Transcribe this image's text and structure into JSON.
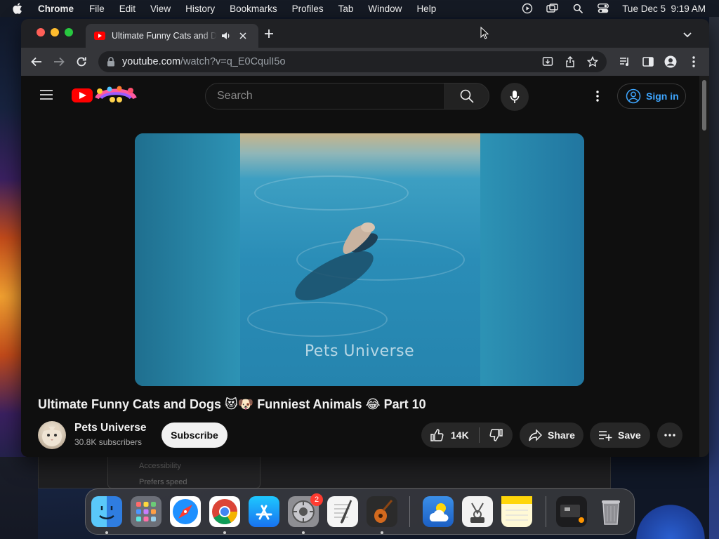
{
  "menubar": {
    "app_name": "Chrome",
    "menus": [
      "File",
      "Edit",
      "View",
      "History",
      "Bookmarks",
      "Profiles",
      "Tab",
      "Window",
      "Help"
    ],
    "datetime": "Tue Dec 5  9:19 AM"
  },
  "browser": {
    "tab_title": "Ultimate Funny Cats and Dogs",
    "url_domain": "youtube.com",
    "url_path": "/watch?v=q_E0CqulI5o"
  },
  "youtube": {
    "search_placeholder": "Search",
    "sign_in_label": "Sign in",
    "video": {
      "watermark": "Pets Universe",
      "title": "Ultimate Funny Cats and Dogs 😻🐶 Funniest Animals 😂 Part 10"
    },
    "channel": {
      "name": "Pets Universe",
      "subscribers": "30.8K subscribers",
      "subscribe_label": "Subscribe"
    },
    "actions": {
      "like_count": "14K",
      "share_label": "Share",
      "save_label": "Save"
    }
  },
  "background_window": {
    "line1": "Accessibility",
    "line2": "Prefers speed"
  },
  "dock": {
    "apps": [
      "Finder",
      "Launchpad",
      "Safari",
      "Google Chrome",
      "App Store",
      "System Settings",
      "TextEdit",
      "GarageBand",
      "Weather",
      "Screenshot",
      "Notes",
      "Downloads",
      "Trash"
    ],
    "system_settings_badge": "2"
  },
  "colors": {
    "youtube_red": "#ff0000",
    "link_blue": "#3ea6ff",
    "page_bg": "#0f0f0f"
  }
}
